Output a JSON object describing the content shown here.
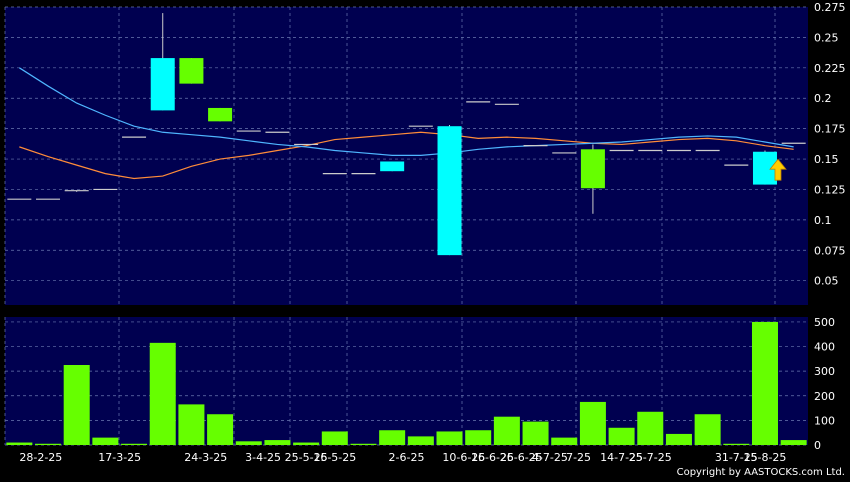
{
  "colors": {
    "background": "#000000",
    "plot_bg": "#000050",
    "grid": "#6a78b0",
    "up_candle": "#00ffff",
    "down_candle": "#66ff00",
    "flat_tick": "#cccccc",
    "ma_short": "#4fb6ff",
    "ma_long": "#ff8c3a",
    "volume_bar": "#66ff00",
    "text": "#ffffff",
    "arrow": "#ffcc00"
  },
  "copyright": "Copyright by AASTOCKS.com Ltd.",
  "chart_data": [
    {
      "type": "candlestick",
      "ylim": [
        0.03,
        0.275
      ],
      "y_ticks": [
        0.05,
        0.075,
        0.1,
        0.125,
        0.15,
        0.175,
        0.2,
        0.225,
        0.25,
        0.275
      ],
      "y_tick_labels": [
        "0.05",
        "0.075",
        "0.1",
        "0.125",
        "0.15",
        "0.175",
        "0.2",
        "0.225",
        "0.25",
        "0.275"
      ],
      "grid": true,
      "ohlc": [
        {
          "open": 0.117,
          "high": 0.117,
          "low": 0.117,
          "close": 0.117
        },
        {
          "open": 0.117,
          "high": 0.117,
          "low": 0.117,
          "close": 0.117
        },
        {
          "open": 0.124,
          "high": 0.124,
          "low": 0.123,
          "close": 0.124
        },
        {
          "open": 0.125,
          "high": 0.125,
          "low": 0.125,
          "close": 0.125
        },
        {
          "open": 0.168,
          "high": 0.168,
          "low": 0.168,
          "close": 0.168
        },
        {
          "open": 0.19,
          "high": 0.27,
          "low": 0.19,
          "close": 0.233
        },
        {
          "open": 0.233,
          "high": 0.233,
          "low": 0.212,
          "close": 0.212
        },
        {
          "open": 0.192,
          "high": 0.192,
          "low": 0.181,
          "close": 0.181
        },
        {
          "open": 0.173,
          "high": 0.173,
          "low": 0.173,
          "close": 0.173
        },
        {
          "open": 0.172,
          "high": 0.172,
          "low": 0.172,
          "close": 0.172
        },
        {
          "open": 0.162,
          "high": 0.162,
          "low": 0.162,
          "close": 0.162
        },
        {
          "open": 0.138,
          "high": 0.138,
          "low": 0.138,
          "close": 0.138
        },
        {
          "open": 0.138,
          "high": 0.138,
          "low": 0.138,
          "close": 0.138
        },
        {
          "open": 0.14,
          "high": 0.148,
          "low": 0.14,
          "close": 0.148
        },
        {
          "open": 0.177,
          "high": 0.177,
          "low": 0.177,
          "close": 0.177
        },
        {
          "open": 0.071,
          "high": 0.178,
          "low": 0.071,
          "close": 0.177
        },
        {
          "open": 0.197,
          "high": 0.197,
          "low": 0.197,
          "close": 0.197
        },
        {
          "open": 0.195,
          "high": 0.195,
          "low": 0.195,
          "close": 0.195
        },
        {
          "open": 0.161,
          "high": 0.161,
          "low": 0.161,
          "close": 0.161
        },
        {
          "open": 0.155,
          "high": 0.155,
          "low": 0.155,
          "close": 0.155
        },
        {
          "open": 0.158,
          "high": 0.162,
          "low": 0.105,
          "close": 0.126
        },
        {
          "open": 0.157,
          "high": 0.157,
          "low": 0.157,
          "close": 0.157
        },
        {
          "open": 0.157,
          "high": 0.157,
          "low": 0.157,
          "close": 0.157
        },
        {
          "open": 0.157,
          "high": 0.157,
          "low": 0.157,
          "close": 0.157
        },
        {
          "open": 0.157,
          "high": 0.157,
          "low": 0.157,
          "close": 0.157
        },
        {
          "open": 0.145,
          "high": 0.145,
          "low": 0.145,
          "close": 0.145
        },
        {
          "open": 0.129,
          "high": 0.157,
          "low": 0.129,
          "close": 0.156
        },
        {
          "open": 0.163,
          "high": 0.163,
          "low": 0.163,
          "close": 0.163
        }
      ],
      "ma_short": [
        0.225,
        0.21,
        0.196,
        0.186,
        0.177,
        0.172,
        0.17,
        0.168,
        0.165,
        0.162,
        0.16,
        0.157,
        0.155,
        0.153,
        0.153,
        0.155,
        0.158,
        0.16,
        0.161,
        0.162,
        0.163,
        0.164,
        0.166,
        0.168,
        0.169,
        0.168,
        0.164,
        0.16
      ],
      "ma_long": [
        0.16,
        0.152,
        0.145,
        0.138,
        0.134,
        0.136,
        0.144,
        0.15,
        0.153,
        0.157,
        0.161,
        0.166,
        0.168,
        0.17,
        0.172,
        0.17,
        0.167,
        0.168,
        0.167,
        0.165,
        0.163,
        0.162,
        0.164,
        0.166,
        0.167,
        0.165,
        0.161,
        0.158
      ]
    },
    {
      "type": "bar",
      "ylim": [
        0,
        520
      ],
      "y_ticks": [
        0,
        100,
        200,
        300,
        400,
        500
      ],
      "y_tick_labels": [
        "0",
        "100",
        "200",
        "300",
        "400",
        "500"
      ],
      "values": [
        10,
        5,
        325,
        30,
        5,
        415,
        165,
        125,
        15,
        20,
        10,
        55,
        5,
        60,
        35,
        55,
        60,
        115,
        95,
        30,
        175,
        70,
        135,
        45,
        125,
        5,
        500,
        20
      ],
      "x_labels": [
        {
          "index": 0.75,
          "label": "28-2-25"
        },
        {
          "index": 3.5,
          "label": "17-3-25"
        },
        {
          "index": 6.5,
          "label": "24-3-25"
        },
        {
          "index": 8.5,
          "label": "3-4-25"
        },
        {
          "index": 10,
          "label": "25-5-25"
        },
        {
          "index": 11,
          "label": "16-5-25"
        },
        {
          "index": 13.5,
          "label": "2-6-25"
        },
        {
          "index": 15.5,
          "label": "10-6-25"
        },
        {
          "index": 16.5,
          "label": "16-6-25"
        },
        {
          "index": 17.5,
          "label": "26-6-25"
        },
        {
          "index": 18.5,
          "label": "4-7-25"
        },
        {
          "index": 19.5,
          "label": "7-25"
        },
        {
          "index": 21,
          "label": "14-7-25"
        },
        {
          "index": 22,
          "label": "25-7-25"
        },
        {
          "index": 25,
          "label": "31-7-25"
        },
        {
          "index": 26,
          "label": "15-8-25"
        }
      ]
    }
  ]
}
